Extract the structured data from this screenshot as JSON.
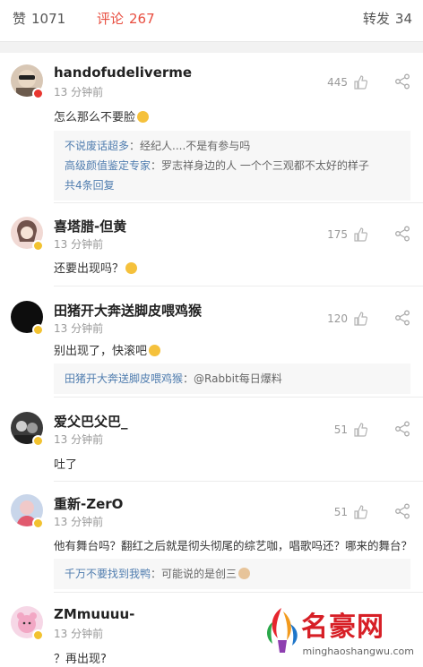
{
  "tabs": {
    "like": {
      "label": "赞",
      "count": "1071"
    },
    "comment": {
      "label": "评论",
      "count": "267"
    },
    "repost": {
      "label": "转发",
      "count": "34"
    }
  },
  "comments": [
    {
      "username": "handofudeliverme",
      "time": "13 分钟前",
      "likes": "445",
      "text": "怎么那么不要脸",
      "badge_color": "#e8362f",
      "replies": [
        {
          "name": "不说废话超多",
          "text": "：经纪人....不是有参与吗"
        },
        {
          "name": "高级颜值鉴定专家",
          "text": "：罗志祥身边的人 一个个三观都不太好的样子"
        }
      ],
      "more": "共4条回复"
    },
    {
      "username": "喜塔腊-但黄",
      "time": "13 分钟前",
      "likes": "175",
      "text": "还要出现吗？",
      "badge_color": "#f2c230"
    },
    {
      "username": "田猪开大奔送脚皮喂鸡猴",
      "time": "13 分钟前",
      "likes": "120",
      "text": "别出现了，快滚吧",
      "badge_color": "#f2c230",
      "replies": [
        {
          "name": "田猪开大奔送脚皮喂鸡猴",
          "text": "：@Rabbit每日爆料"
        }
      ]
    },
    {
      "username": "爱父巴父巴_",
      "time": "13 分钟前",
      "likes": "51",
      "text": "吐了",
      "badge_color": "#f2c230"
    },
    {
      "username": "重新-ZerO",
      "time": "13 分钟前",
      "likes": "51",
      "text": "他有舞台吗？翻红之后就是彻头彻尾的综艺咖，唱歌吗还？哪来的舞台？",
      "badge_color": "#f2c230",
      "replies": [
        {
          "name": "千万不要找到我鸭",
          "text": "：可能说的是创三"
        }
      ]
    },
    {
      "username": "ZMmuuuu-",
      "time": "13 分钟前",
      "text": "？再出现?",
      "badge_color": "#f2c230"
    }
  ],
  "watermark": {
    "name": "名豪网",
    "url": "minghaoshangwu.com"
  },
  "colors": {
    "accent": "#e84e40",
    "link": "#507daf"
  }
}
